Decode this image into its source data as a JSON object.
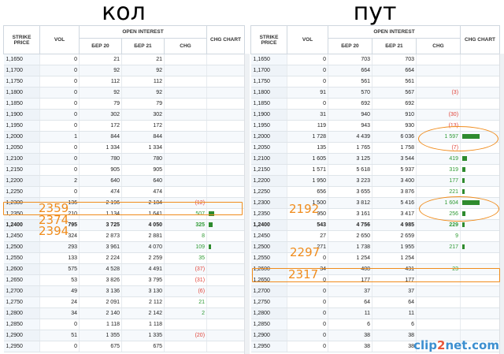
{
  "left": {
    "title": "кол",
    "headers": {
      "strike": "STRIKE PRICE",
      "vol": "VOL",
      "oi": "OPEN INTEREST",
      "ber20": "БЕР 20",
      "ber21": "БЕР 21",
      "chg": "CHG",
      "chart": "CHG CHART"
    },
    "rows": [
      {
        "strike": "1,1650",
        "vol": "0",
        "ber20": "21",
        "ber21": "21",
        "chg": "",
        "chart": 0
      },
      {
        "strike": "1,1700",
        "vol": "0",
        "ber20": "92",
        "ber21": "92",
        "chg": "",
        "chart": 0
      },
      {
        "strike": "1,1750",
        "vol": "0",
        "ber20": "112",
        "ber21": "112",
        "chg": "",
        "chart": 0
      },
      {
        "strike": "1,1800",
        "vol": "0",
        "ber20": "92",
        "ber21": "92",
        "chg": "",
        "chart": 0
      },
      {
        "strike": "1,1850",
        "vol": "0",
        "ber20": "79",
        "ber21": "79",
        "chg": "",
        "chart": 0
      },
      {
        "strike": "1,1900",
        "vol": "0",
        "ber20": "302",
        "ber21": "302",
        "chg": "",
        "chart": 0
      },
      {
        "strike": "1,1950",
        "vol": "0",
        "ber20": "172",
        "ber21": "172",
        "chg": "",
        "chart": 0
      },
      {
        "strike": "1,2000",
        "vol": "1",
        "ber20": "844",
        "ber21": "844",
        "chg": "",
        "chart": 0
      },
      {
        "strike": "1,2050",
        "vol": "0",
        "ber20": "1 334",
        "ber21": "1 334",
        "chg": "",
        "chart": 0
      },
      {
        "strike": "1,2100",
        "vol": "0",
        "ber20": "780",
        "ber21": "780",
        "chg": "",
        "chart": 0
      },
      {
        "strike": "1,2150",
        "vol": "0",
        "ber20": "905",
        "ber21": "905",
        "chg": "",
        "chart": 0
      },
      {
        "strike": "1,2200",
        "vol": "2",
        "ber20": "640",
        "ber21": "640",
        "chg": "",
        "chart": 0
      },
      {
        "strike": "1,2250",
        "vol": "0",
        "ber20": "474",
        "ber21": "474",
        "chg": "",
        "chart": 0
      },
      {
        "strike": "1,2300",
        "vol": "136",
        "ber20": "2 196",
        "ber21": "2 184",
        "chg": "(12)",
        "chart": 0
      },
      {
        "strike": "1,2350",
        "vol": "210",
        "ber20": "1 134",
        "ber21": "1 641",
        "chg": "507",
        "chart": 0.3
      },
      {
        "strike": "1,2400",
        "vol": "795",
        "ber20": "3 725",
        "ber21": "4 050",
        "chg": "325",
        "chart": 0.2,
        "bold": true
      },
      {
        "strike": "1,2450",
        "vol": "324",
        "ber20": "2 873",
        "ber21": "2 881",
        "chg": "8",
        "chart": 0
      },
      {
        "strike": "1,2500",
        "vol": "293",
        "ber20": "3 961",
        "ber21": "4 070",
        "chg": "109",
        "chart": 0.05
      },
      {
        "strike": "1,2550",
        "vol": "133",
        "ber20": "2 224",
        "ber21": "2 259",
        "chg": "35",
        "chart": 0
      },
      {
        "strike": "1,2600",
        "vol": "575",
        "ber20": "4 528",
        "ber21": "4 491",
        "chg": "(37)",
        "chart": 0
      },
      {
        "strike": "1,2650",
        "vol": "53",
        "ber20": "3 826",
        "ber21": "3 795",
        "chg": "(31)",
        "chart": 0
      },
      {
        "strike": "1,2700",
        "vol": "49",
        "ber20": "3 136",
        "ber21": "3 130",
        "chg": "(6)",
        "chart": 0
      },
      {
        "strike": "1,2750",
        "vol": "24",
        "ber20": "2 091",
        "ber21": "2 112",
        "chg": "21",
        "chart": 0
      },
      {
        "strike": "1,2800",
        "vol": "34",
        "ber20": "2 140",
        "ber21": "2 142",
        "chg": "2",
        "chart": 0
      },
      {
        "strike": "1,2850",
        "vol": "0",
        "ber20": "1 118",
        "ber21": "1 118",
        "chg": "",
        "chart": 0
      },
      {
        "strike": "1,2900",
        "vol": "51",
        "ber20": "1 355",
        "ber21": "1 335",
        "chg": "(20)",
        "chart": 0
      },
      {
        "strike": "1,2950",
        "vol": "0",
        "ber20": "675",
        "ber21": "675",
        "chg": "",
        "chart": 0
      }
    ],
    "notes": [
      "2359",
      "2374",
      "2394"
    ]
  },
  "right": {
    "title": "пут",
    "headers": {
      "strike": "STRIKE PRICE",
      "vol": "VOL",
      "oi": "OPEN INTEREST",
      "ber20": "БЕР 20",
      "ber21": "БЕР 21",
      "chg": "CHG",
      "chart": "CHG CHART"
    },
    "rows": [
      {
        "strike": "1,1650",
        "vol": "0",
        "ber20": "703",
        "ber21": "703",
        "chg": "",
        "chart": 0
      },
      {
        "strike": "1,1700",
        "vol": "0",
        "ber20": "664",
        "ber21": "664",
        "chg": "",
        "chart": 0
      },
      {
        "strike": "1,1750",
        "vol": "0",
        "ber20": "561",
        "ber21": "561",
        "chg": "",
        "chart": 0
      },
      {
        "strike": "1,1800",
        "vol": "91",
        "ber20": "570",
        "ber21": "567",
        "chg": "(3)",
        "chart": 0
      },
      {
        "strike": "1,1850",
        "vol": "0",
        "ber20": "692",
        "ber21": "692",
        "chg": "",
        "chart": 0
      },
      {
        "strike": "1,1900",
        "vol": "31",
        "ber20": "940",
        "ber21": "910",
        "chg": "(30)",
        "chart": 0
      },
      {
        "strike": "1,1950",
        "vol": "119",
        "ber20": "943",
        "ber21": "930",
        "chg": "(13)",
        "chart": 0
      },
      {
        "strike": "1,2000",
        "vol": "1 728",
        "ber20": "4 439",
        "ber21": "6 036",
        "chg": "1 597",
        "chart": 1.0
      },
      {
        "strike": "1,2050",
        "vol": "135",
        "ber20": "1 765",
        "ber21": "1 758",
        "chg": "(7)",
        "chart": 0
      },
      {
        "strike": "1,2100",
        "vol": "1 605",
        "ber20": "3 125",
        "ber21": "3 544",
        "chg": "419",
        "chart": 0.26
      },
      {
        "strike": "1,2150",
        "vol": "1 571",
        "ber20": "5 618",
        "ber21": "5 937",
        "chg": "319",
        "chart": 0.2
      },
      {
        "strike": "1,2200",
        "vol": "1 950",
        "ber20": "3 223",
        "ber21": "3 400",
        "chg": "177",
        "chart": 0.11
      },
      {
        "strike": "1,2250",
        "vol": "656",
        "ber20": "3 655",
        "ber21": "3 876",
        "chg": "221",
        "chart": 0.14
      },
      {
        "strike": "1,2300",
        "vol": "1 500",
        "ber20": "3 812",
        "ber21": "5 416",
        "chg": "1 604",
        "chart": 1.0
      },
      {
        "strike": "1,2350",
        "vol": "950",
        "ber20": "3 161",
        "ber21": "3 417",
        "chg": "256",
        "chart": 0.16
      },
      {
        "strike": "1,2400",
        "vol": "543",
        "ber20": "4 756",
        "ber21": "4 985",
        "chg": "229",
        "chart": 0.14,
        "bold": true
      },
      {
        "strike": "1,2450",
        "vol": "27",
        "ber20": "2 650",
        "ber21": "2 659",
        "chg": "9",
        "chart": 0
      },
      {
        "strike": "1,2500",
        "vol": "271",
        "ber20": "1 738",
        "ber21": "1 955",
        "chg": "217",
        "chart": 0.13
      },
      {
        "strike": "1,2550",
        "vol": "0",
        "ber20": "1 254",
        "ber21": "1 254",
        "chg": "",
        "chart": 0
      },
      {
        "strike": "1,2600",
        "vol": "34",
        "ber20": "408",
        "ber21": "431",
        "chg": "23",
        "chart": 0
      },
      {
        "strike": "1,2650",
        "vol": "0",
        "ber20": "177",
        "ber21": "177",
        "chg": "",
        "chart": 0
      },
      {
        "strike": "1,2700",
        "vol": "0",
        "ber20": "37",
        "ber21": "37",
        "chg": "",
        "chart": 0
      },
      {
        "strike": "1,2750",
        "vol": "0",
        "ber20": "64",
        "ber21": "64",
        "chg": "",
        "chart": 0
      },
      {
        "strike": "1,2800",
        "vol": "0",
        "ber20": "11",
        "ber21": "11",
        "chg": "",
        "chart": 0
      },
      {
        "strike": "1,2850",
        "vol": "0",
        "ber20": "6",
        "ber21": "6",
        "chg": "",
        "chart": 0
      },
      {
        "strike": "1,2900",
        "vol": "0",
        "ber20": "38",
        "ber21": "38",
        "chg": "",
        "chart": 0
      },
      {
        "strike": "1,2950",
        "vol": "0",
        "ber20": "38",
        "ber21": "38",
        "chg": "",
        "chart": 0
      }
    ],
    "notes": [
      "2192",
      "2297",
      "2317"
    ]
  },
  "colors": {
    "accent": "#f08c1c",
    "positive": "#2f9a34",
    "negative": "#e0443a",
    "bar": "#2e8b2e"
  },
  "watermark": {
    "part1": "clip",
    "part2": "2",
    "part3": "net.com"
  }
}
